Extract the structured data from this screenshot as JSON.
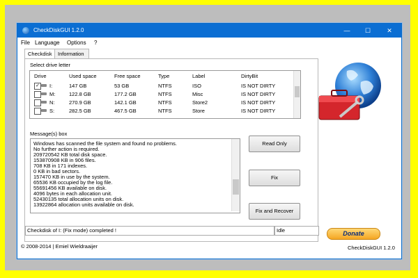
{
  "window": {
    "title": "CheckDiskGUI 1.2.0",
    "minimize": "—",
    "maximize": "☐",
    "close": "✕"
  },
  "menu": [
    "File",
    "Language",
    "Options",
    "?"
  ],
  "tabs": [
    "Checkdisk",
    "Information"
  ],
  "drive_group": {
    "label": "Select drive letter",
    "columns": [
      "Drive",
      "Used space",
      "Free space",
      "Type",
      "Label",
      "DirtyBit"
    ],
    "rows": [
      {
        "checked": true,
        "drive": "I:",
        "used": "147 GB",
        "free": "53 GB",
        "type": "NTFS",
        "label": "ISO",
        "dirty": "IS NOT DIRTY"
      },
      {
        "checked": false,
        "drive": "M:",
        "used": "122.8 GB",
        "free": "177.2 GB",
        "type": "NTFS",
        "label": "Misc",
        "dirty": "IS NOT DIRTY"
      },
      {
        "checked": false,
        "drive": "N:",
        "used": "270.9 GB",
        "free": "142.1 GB",
        "type": "NTFS",
        "label": "Store2",
        "dirty": "IS NOT DIRTY"
      },
      {
        "checked": false,
        "drive": "S:",
        "used": "282.5 GB",
        "free": "467.5 GB",
        "type": "NTFS",
        "label": "Store",
        "dirty": "IS NOT DIRTY"
      }
    ]
  },
  "message_group": {
    "label": "Message(s) box",
    "lines": [
      "Windows has scanned the file system and found no problems.",
      "No further action is required.",
      "  209720542 KB total disk space.",
      "  153870908 KB in 906 files.",
      "  708 KB in 171 indexes.",
      "  0 KB in bad sectors.",
      "  157470 KB in use by the system.",
      "  65536 KB occupied by the log file.",
      "  55691456 KB available on disk.",
      "  4096 bytes in each allocation unit.",
      "  52430135 total allocation units on disk.",
      "  13922864 allocation units available on disk."
    ]
  },
  "buttons": {
    "read_only": "Read Only",
    "fix": "Fix",
    "fix_recover": "Fix and Recover",
    "donate": "Donate"
  },
  "status": {
    "main": "Checkdisk of I: (Fix mode) completed !",
    "state": "Idle"
  },
  "footer": {
    "copyright": "© 2008-2014 | Emiel Wieldraaijer",
    "version": "CheckDiskGUI 1.2.0"
  },
  "colors": {
    "background": "#ffff00",
    "titlebar": "#0b6ed3"
  }
}
